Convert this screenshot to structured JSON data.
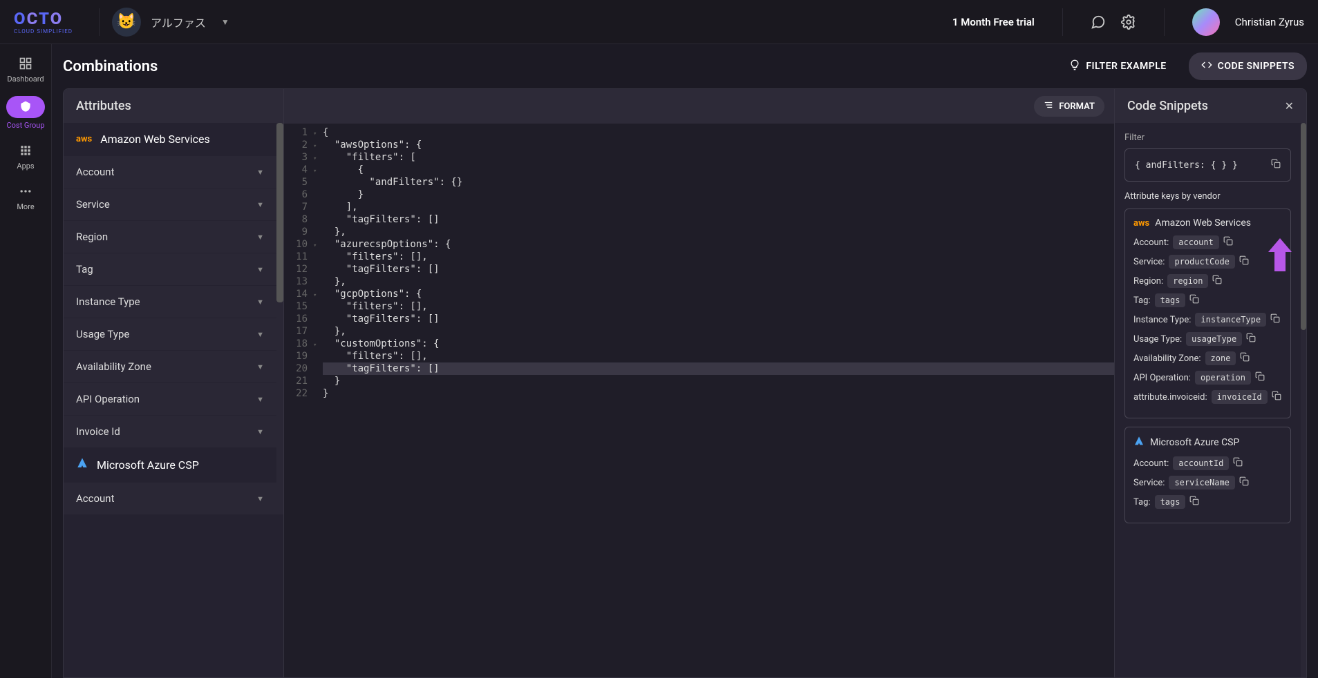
{
  "header": {
    "logo_main": "OCTO",
    "logo_sub": "CLOUD SIMPLIFIED",
    "tenant_name": "アルファス",
    "trial_text": "1 Month Free trial",
    "user_name": "Christian Zyrus"
  },
  "sidenav": {
    "items": [
      {
        "label": "Dashboard",
        "active": false
      },
      {
        "label": "Cost Group",
        "active": true
      },
      {
        "label": "Apps",
        "active": false
      },
      {
        "label": "More",
        "active": false
      }
    ]
  },
  "page": {
    "title": "Combinations",
    "filter_example": "FILTER EXAMPLE",
    "code_snippets": "CODE SNIPPETS"
  },
  "attributes": {
    "title": "Attributes",
    "vendors": [
      {
        "name": "Amazon Web Services",
        "icon": "aws",
        "items": [
          "Account",
          "Service",
          "Region",
          "Tag",
          "Instance Type",
          "Usage Type",
          "Availability Zone",
          "API Operation",
          "Invoice Id"
        ]
      },
      {
        "name": "Microsoft Azure CSP",
        "icon": "azure",
        "items": [
          "Account"
        ]
      }
    ]
  },
  "editor": {
    "format_label": "FORMAT",
    "lines": [
      "{",
      "  \"awsOptions\": {",
      "    \"filters\": [",
      "      {",
      "        \"andFilters\": {}",
      "      }",
      "    ],",
      "    \"tagFilters\": []",
      "  },",
      "  \"azurecspOptions\": {",
      "    \"filters\": [],",
      "    \"tagFilters\": []",
      "  },",
      "  \"gcpOptions\": {",
      "    \"filters\": [],",
      "    \"tagFilters\": []",
      "  },",
      "  \"customOptions\": {",
      "    \"filters\": [],",
      "    \"tagFilters\": []",
      "  }",
      "}"
    ],
    "highlighted_line": 20,
    "fold_lines": [
      1,
      2,
      3,
      4,
      10,
      14,
      18
    ]
  },
  "snippets": {
    "title": "Code Snippets",
    "filter_label": "Filter",
    "filter_code": "{ andFilters: { } }",
    "attr_label": "Attribute keys by vendor",
    "vendors": [
      {
        "name": "Amazon Web Services",
        "icon": "aws",
        "rows": [
          {
            "label": "Account:",
            "val": "account"
          },
          {
            "label": "Service:",
            "val": "productCode"
          },
          {
            "label": "Region:",
            "val": "region"
          },
          {
            "label": "Tag:",
            "val": "tags"
          },
          {
            "label": "Instance Type:",
            "val": "instanceType"
          },
          {
            "label": "Usage Type:",
            "val": "usageType"
          },
          {
            "label": "Availability Zone:",
            "val": "zone"
          },
          {
            "label": "API Operation:",
            "val": "operation"
          },
          {
            "label": "attribute.invoiceid:",
            "val": "invoiceId"
          }
        ]
      },
      {
        "name": "Microsoft Azure CSP",
        "icon": "azure",
        "rows": [
          {
            "label": "Account:",
            "val": "accountId"
          },
          {
            "label": "Service:",
            "val": "serviceName"
          },
          {
            "label": "Tag:",
            "val": "tags"
          }
        ]
      }
    ]
  }
}
